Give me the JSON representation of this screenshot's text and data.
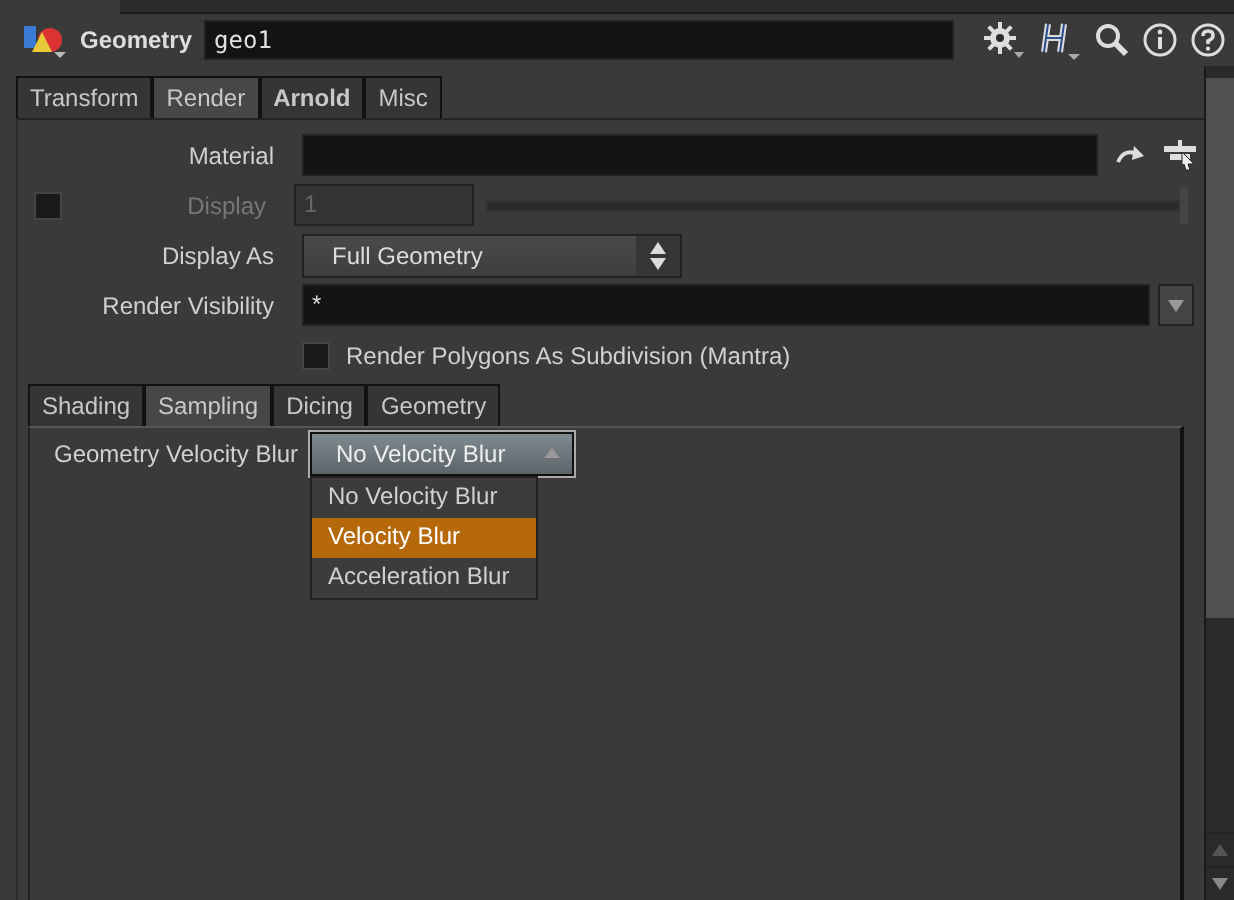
{
  "header": {
    "type_label": "Geometry",
    "node_name": "geo1"
  },
  "tabs": [
    {
      "label": "Transform",
      "selected": false
    },
    {
      "label": "Render",
      "selected": true
    },
    {
      "label": "Arnold",
      "selected": false
    },
    {
      "label": "Misc",
      "selected": false
    }
  ],
  "params": [
    {
      "kind": "text",
      "label": "Material",
      "disabled": false
    },
    {
      "kind": "slider",
      "label": "Display",
      "value": "1",
      "disabled": true,
      "toggle_checked": false
    },
    {
      "kind": "menu",
      "label": "Display As",
      "value": "Full Geometry",
      "disabled": false
    },
    {
      "kind": "textmenu",
      "label": "Render Visibility",
      "value": "*",
      "disabled": false
    },
    {
      "kind": "checkbox",
      "label": "Render Polygons As Subdivision (Mantra)",
      "checked": false,
      "disabled": false
    }
  ],
  "subtabs": [
    {
      "label": "Shading",
      "selected": false
    },
    {
      "label": "Sampling",
      "selected": true
    },
    {
      "label": "Dicing",
      "selected": false
    },
    {
      "label": "Geometry",
      "selected": false
    }
  ],
  "velocity_blur": {
    "label": "Geometry Velocity Blur",
    "value": "No Velocity Blur",
    "expanded": true,
    "options": [
      {
        "label": "No Velocity Blur",
        "highlighted": false
      },
      {
        "label": "Velocity Blur",
        "highlighted": true
      },
      {
        "label": "Acceleration Blur",
        "highlighted": false
      }
    ]
  }
}
